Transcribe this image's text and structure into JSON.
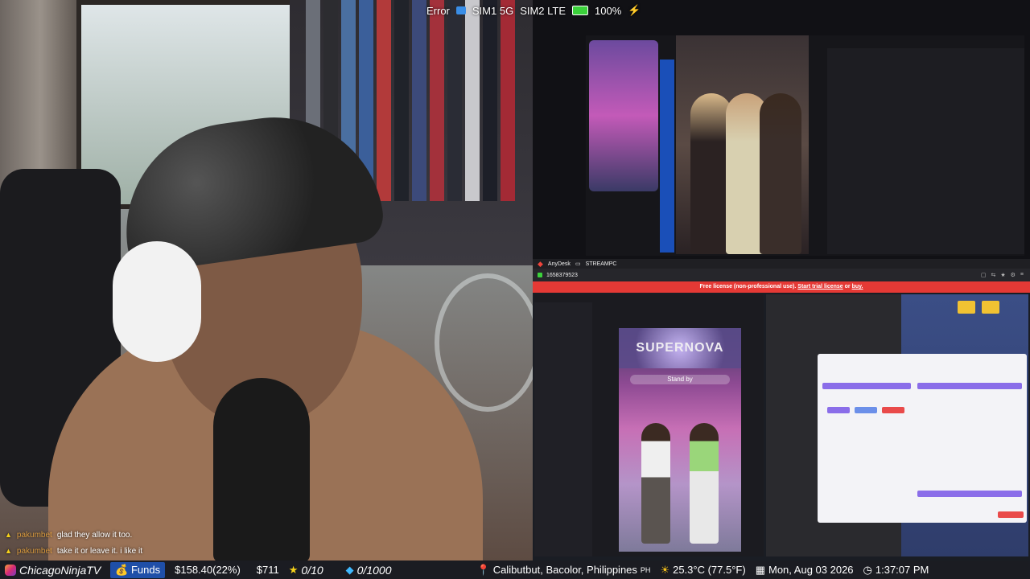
{
  "status_bar": {
    "error": "Error",
    "sim1": "SIM1 5G",
    "sim2": "SIM2 LTE",
    "battery": "100%"
  },
  "chat": {
    "messages": [
      {
        "user": "pakumbet",
        "text": "glad they allow it too."
      },
      {
        "user": "pakumbet",
        "text": "take it or leave it. i like it"
      }
    ]
  },
  "anydesk": {
    "app_name": "AnyDesk",
    "tab": "STREAMPC",
    "address": "1658379523",
    "banner_prefix": "Free license (non-professional use).",
    "banner_link1": "Start trial license",
    "banner_or": "or",
    "banner_link2": "buy."
  },
  "remote": {
    "stream_title": "SUPERNOVA",
    "standby_text": "Stand by"
  },
  "bottom_bar": {
    "channel": "ChicagoNinjaTV",
    "funds_label": "Funds",
    "funds_value": "$158.40(22%)",
    "goal_value": "$711",
    "stars": "0/10",
    "diamonds": "0/1000",
    "location": "Calibutbut, Bacolor, Philippines",
    "country_code": "PH",
    "temperature": "25.3°C (77.5°F)",
    "date": "Mon, Aug 03 2026",
    "time": "1:37:07 PM"
  },
  "colors": {
    "anydesk_red": "#e53935",
    "funds_blue": "#1f4fa8",
    "star_yellow": "#f7d21a",
    "diamond_blue": "#3fb9ff"
  },
  "icons": [
    "wifi-signal-icon",
    "battery-icon",
    "charging-bolt-icon",
    "instagram-icon",
    "money-bag-icon",
    "star-icon",
    "diamond-icon",
    "location-pin-icon",
    "weather-sun-icon",
    "calendar-icon",
    "clock-icon",
    "anydesk-logo-icon",
    "monitor-icon"
  ]
}
